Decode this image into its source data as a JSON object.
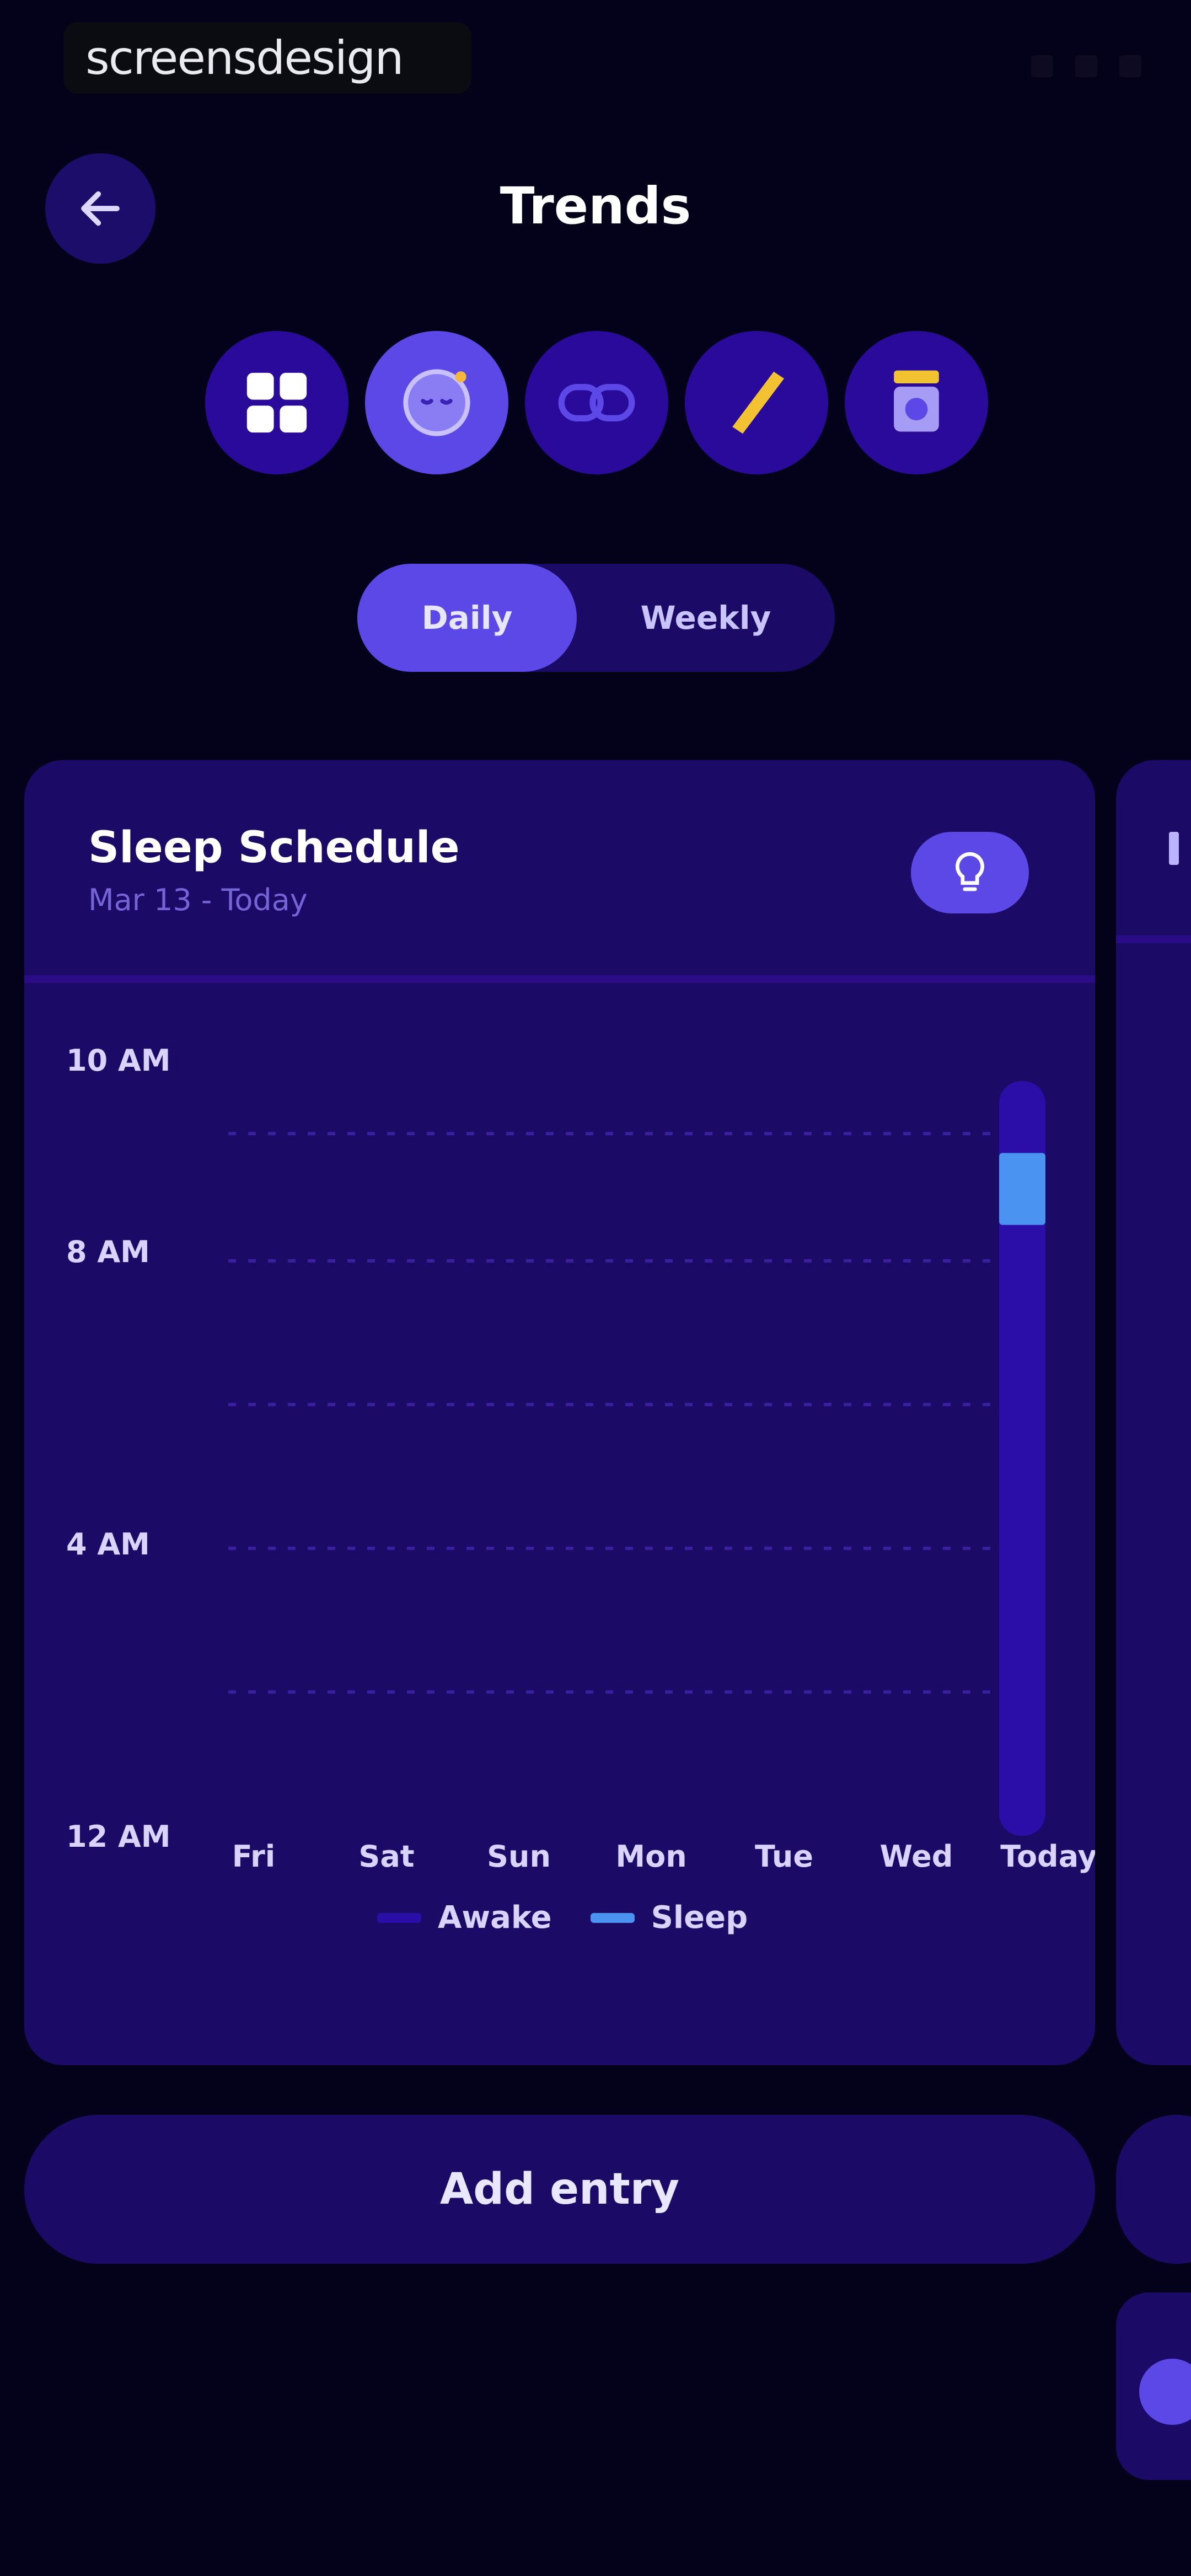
{
  "watermark": "screensdesign",
  "header": {
    "title": "Trends"
  },
  "categories": [
    {
      "name": "overview",
      "icon": "grid-icon",
      "active": false
    },
    {
      "name": "sleep",
      "icon": "sleep-moon-icon",
      "active": true
    },
    {
      "name": "link",
      "icon": "link-icon",
      "active": false
    },
    {
      "name": "length",
      "icon": "ruler-icon",
      "active": false
    },
    {
      "name": "weight",
      "icon": "scale-icon",
      "active": false
    }
  ],
  "segment": {
    "daily": "Daily",
    "weekly": "Weekly",
    "selected": "Daily"
  },
  "card": {
    "title": "Sleep Schedule",
    "subtitle": "Mar 13 - Today"
  },
  "chart_data": {
    "type": "bar",
    "title": "Sleep Schedule",
    "categories": [
      "Fri",
      "Sat",
      "Sun",
      "Mon",
      "Tue",
      "Wed",
      "Today"
    ],
    "y_ticks": [
      "10 AM",
      "8 AM",
      "4 AM",
      "12 AM"
    ],
    "series": [
      {
        "name": "Awake",
        "color": "#2b0ea8",
        "ranges": [
          null,
          null,
          null,
          null,
          null,
          null,
          [
            0,
            10.5
          ]
        ]
      },
      {
        "name": "Sleep",
        "color": "#4b93f0",
        "ranges": [
          null,
          null,
          null,
          null,
          null,
          null,
          [
            8.5,
            9.5
          ]
        ]
      }
    ],
    "grid": true,
    "legend": "bottom"
  },
  "add_entry": "Add entry",
  "colors": {
    "background": "#04021a",
    "card": "#1b0a66",
    "accent": "#5b48e6",
    "sleep": "#4b93f0",
    "awake": "#2b0ea8"
  }
}
